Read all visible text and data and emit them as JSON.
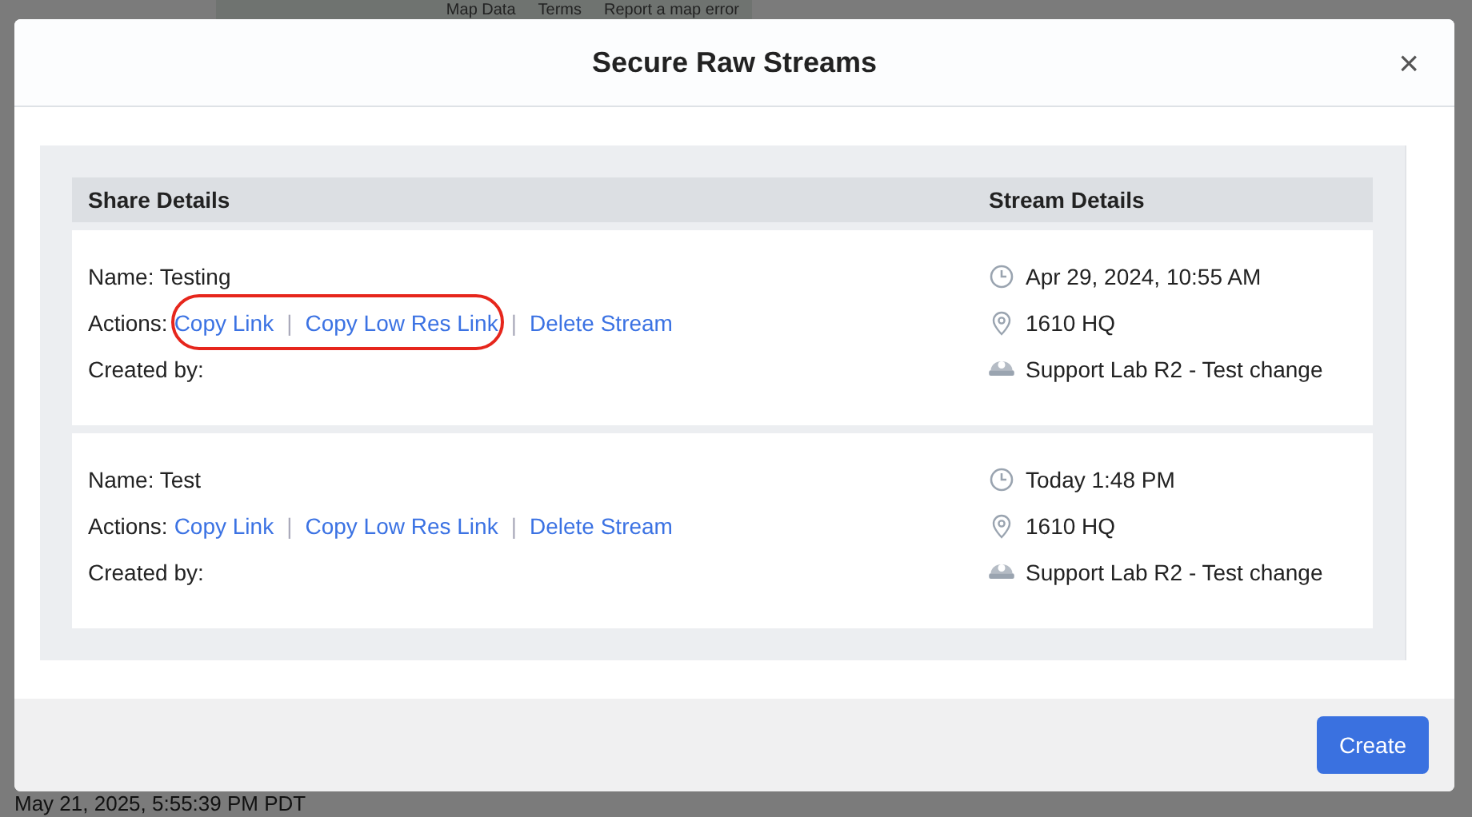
{
  "background": {
    "map_links": [
      "Map Data",
      "Terms",
      "Report a map error"
    ],
    "timestamp": "May 21, 2025, 5:55:39 PM PDT"
  },
  "dialog": {
    "title": "Secure Raw Streams",
    "close": "×",
    "separator": "|",
    "table": {
      "columns": [
        "Share Details",
        "Stream Details"
      ],
      "rows": [
        {
          "name": "Name: Testing",
          "actions_label": "Actions:",
          "actions": [
            "Copy Link",
            "Copy Low Res Link",
            "Delete Stream"
          ],
          "created_by": "Created by:",
          "highlighted": true,
          "time": "Apr 29, 2024, 10:55 AM",
          "site": "1610 HQ",
          "camera": "Support Lab R2 - Test change"
        },
        {
          "name": "Name: Test",
          "actions_label": "Actions:",
          "actions": [
            "Copy Link",
            "Copy Low Res Link",
            "Delete Stream"
          ],
          "created_by": "Created by:",
          "highlighted": false,
          "time": "Today 1:48 PM",
          "site": "1610 HQ",
          "camera": "Support Lab R2 - Test change"
        }
      ]
    },
    "buttons": [
      "Create"
    ]
  }
}
